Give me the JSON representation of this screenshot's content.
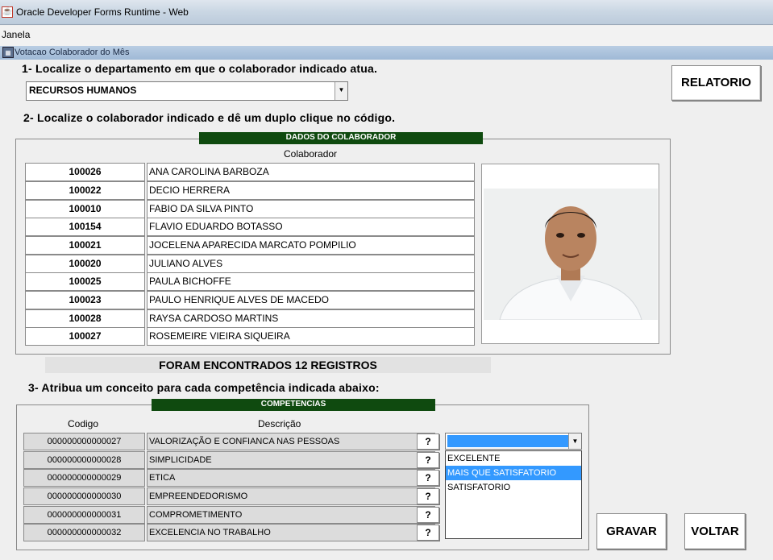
{
  "window": {
    "title": "Oracle Developer Forms Runtime - Web"
  },
  "menu": {
    "items": [
      "Janela"
    ]
  },
  "form": {
    "title": "Votacao Colaborador do Mês"
  },
  "step1": {
    "label": "1- Localize o departamento em que o colaborador indicado atua.",
    "department_selected": "RECURSOS HUMANOS"
  },
  "report_button": "RELATORIO",
  "step2": {
    "label": "2- Localize o colaborador indicado e dê um duplo clique no código."
  },
  "collaborator_panel": {
    "title": "DADOS DO COLABORADOR",
    "column_header": "Colaborador",
    "rows": [
      {
        "code": "100026",
        "name": "ANA CAROLINA BARBOZA"
      },
      {
        "code": "100022",
        "name": "DECIO HERRERA"
      },
      {
        "code": "100010",
        "name": "FABIO DA SILVA PINTO"
      },
      {
        "code": "100154",
        "name": "FLAVIO EDUARDO BOTASSO"
      },
      {
        "code": "100021",
        "name": "JOCELENA APARECIDA MARCATO POMPILIO"
      },
      {
        "code": "100020",
        "name": "JULIANO ALVES"
      },
      {
        "code": "100025",
        "name": "PAULA BICHOFFE"
      },
      {
        "code": "100023",
        "name": "PAULO HENRIQUE ALVES DE MACEDO"
      },
      {
        "code": "100028",
        "name": "RAYSA CARDOSO MARTINS"
      },
      {
        "code": "100027",
        "name": "ROSEMEIRE VIEIRA SIQUEIRA"
      }
    ]
  },
  "records_found": "FORAM ENCONTRADOS 12 REGISTROS",
  "step3": {
    "label": "3- Atribua um conceito para cada competência indicada abaixo:"
  },
  "competencies_panel": {
    "title": "COMPETENCIAS",
    "header_code": "Codigo",
    "header_desc": "Descrição",
    "help_label": "?",
    "rows": [
      {
        "code": "000000000000027",
        "desc": "VALORIZAÇÃO E CONFIANCA NAS PESSOAS"
      },
      {
        "code": "000000000000028",
        "desc": "SIMPLICIDADE"
      },
      {
        "code": "000000000000029",
        "desc": "ETICA"
      },
      {
        "code": "000000000000030",
        "desc": "EMPREENDEDORISMO"
      },
      {
        "code": "000000000000031",
        "desc": "COMPROMETIMENTO"
      },
      {
        "code": "000000000000032",
        "desc": "EXCELENCIA NO TRABALHO"
      }
    ]
  },
  "concept_dropdown": {
    "selected": "",
    "options": [
      "EXCELENTE",
      "MAIS QUE SATISFATORIO",
      "SATISFATORIO"
    ],
    "highlighted_index": 1
  },
  "buttons": {
    "save": "GRAVAR",
    "back": "VOLTAR"
  },
  "colors": {
    "panel_title_bg": "#0f4a0f",
    "highlight": "#3399ff",
    "form_bar": "#a9c2dd"
  }
}
